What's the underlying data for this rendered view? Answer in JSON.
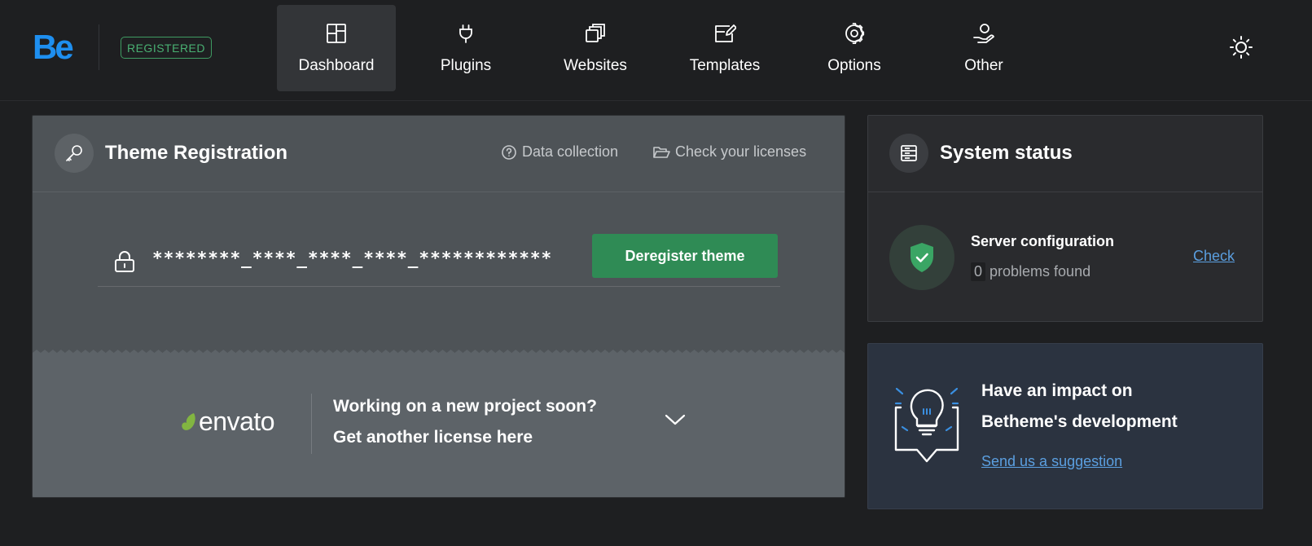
{
  "header": {
    "logo_text": "Be",
    "badge": "REGISTERED",
    "nav": [
      {
        "label": "Dashboard",
        "icon": "layout-grid-icon",
        "active": true
      },
      {
        "label": "Plugins",
        "icon": "plug-icon"
      },
      {
        "label": "Websites",
        "icon": "copy-pages-icon"
      },
      {
        "label": "Templates",
        "icon": "template-edit-icon"
      },
      {
        "label": "Options",
        "icon": "gear-icon"
      },
      {
        "label": "Other",
        "icon": "user-hand-icon"
      }
    ],
    "theme_toggle_icon": "sun-icon"
  },
  "registration": {
    "title": "Theme Registration",
    "data_collection": "Data collection",
    "check_licenses": "Check your licenses",
    "license_key": "********_****_****_****_************",
    "deregister_label": "Deregister theme",
    "envato_text": "envato",
    "promo_line1": "Working on a new project soon?",
    "promo_line2": "Get another license here"
  },
  "system_status": {
    "title": "System status",
    "server_title": "Server configuration",
    "problems_count": "0",
    "problems_text": "problems found",
    "check_label": "Check"
  },
  "suggestion": {
    "line1": "Have an impact on",
    "line2": "Betheme's development",
    "link": "Send us a suggestion"
  },
  "colors": {
    "accent_blue": "#1e8ff0",
    "success_green": "#2f8b55",
    "link_blue": "#5b9fe0",
    "envato_green": "#82b541"
  }
}
